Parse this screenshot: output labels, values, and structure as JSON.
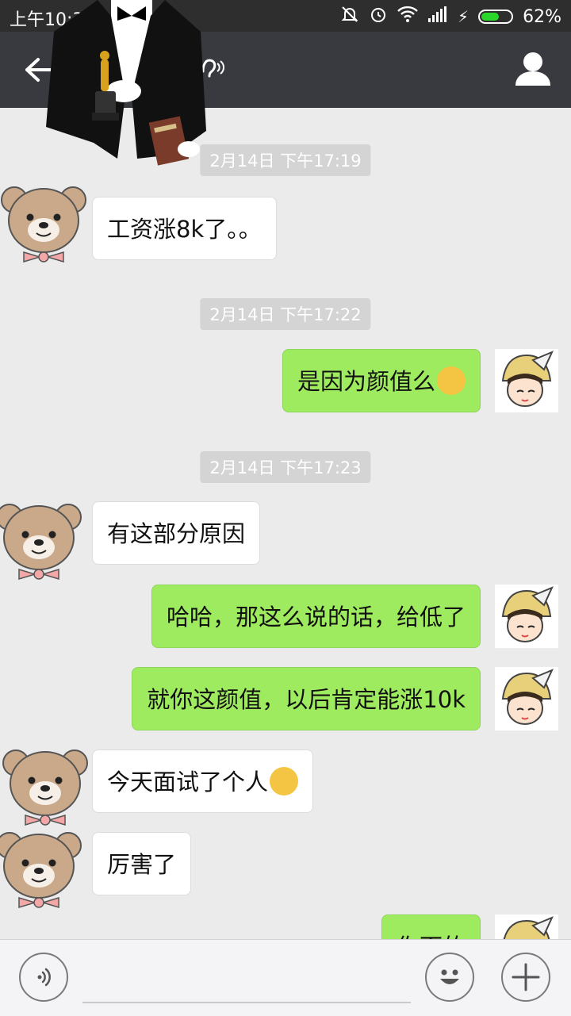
{
  "status_bar": {
    "time": "上午10:35",
    "battery": "62%",
    "battery_fraction": 0.62
  },
  "header": {
    "back_icon": "arrow-left-icon",
    "earpiece_icon": "earpiece-mode-icon",
    "profile_icon": "person-icon",
    "overlay": "tuxedo-oscar-sticker"
  },
  "messages": [
    {
      "type": "timestamp",
      "text": "2月14日 下午17:19"
    },
    {
      "type": "incoming",
      "text": "工资涨8k了。。",
      "avatar": "teddy-bear"
    },
    {
      "type": "timestamp",
      "text": "2月14日 下午17:22"
    },
    {
      "type": "outgoing",
      "text": "是因为颜值么",
      "emoji": "thinking-face",
      "avatar": "cartoon-girl-hat"
    },
    {
      "type": "timestamp",
      "text": "2月14日 下午17:23"
    },
    {
      "type": "incoming",
      "text": "有这部分原因",
      "avatar": "teddy-bear"
    },
    {
      "type": "outgoing",
      "text": "哈哈，那这么说的话，给低了",
      "avatar": "cartoon-girl-hat"
    },
    {
      "type": "outgoing",
      "text": "就你这颜值，以后肯定能涨10k",
      "avatar": "cartoon-girl-hat"
    },
    {
      "type": "incoming",
      "text": "今天面试了个人",
      "emoji": "hugging-face",
      "avatar": "teddy-bear"
    },
    {
      "type": "incoming",
      "text": "厉害了",
      "avatar": "teddy-bear"
    },
    {
      "type": "outgoing",
      "text": "你面的",
      "avatar": "cartoon-girl-hat"
    }
  ],
  "bottom_bar": {
    "voice_icon": "voice-input-icon",
    "emoji_icon": "smiley-icon",
    "plus_icon": "plus-icon"
  },
  "colors": {
    "header_bg": "#393a3f",
    "statusbar_bg": "#2e2e2e",
    "chat_bg": "#ebebeb",
    "outgoing_bubble": "#9feb5f",
    "incoming_bubble": "#ffffff",
    "battery_fill": "#2bd62b"
  }
}
